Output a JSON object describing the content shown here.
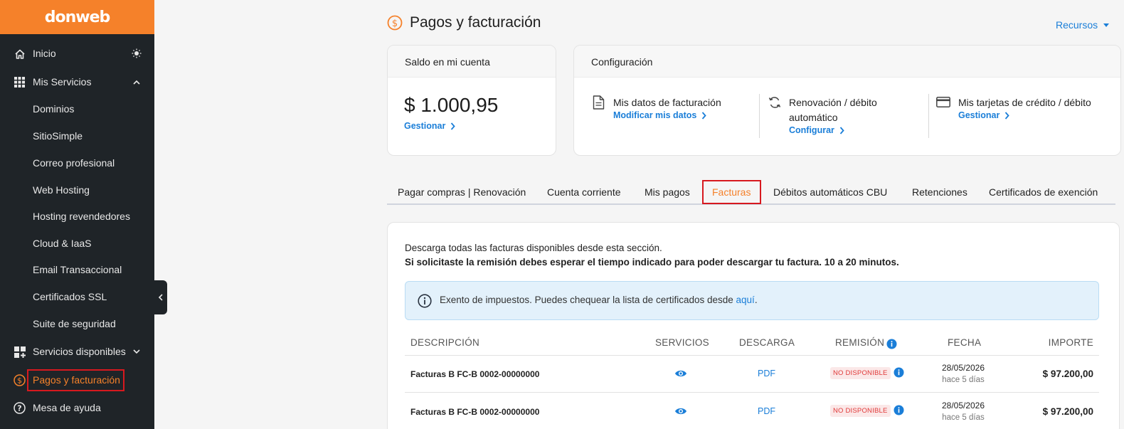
{
  "brand": {
    "logo": "donweb",
    "accent": "#f5812a",
    "link_color": "#1a7ed8"
  },
  "sidebar": {
    "items": [
      {
        "label": "Inicio",
        "icon": "home-icon",
        "right_icon": "sun-icon"
      },
      {
        "label": "Mis Servicios",
        "icon": "grid-icon",
        "right_icon": "chevron-up-icon"
      },
      {
        "label": "Dominios"
      },
      {
        "label": "SitioSimple"
      },
      {
        "label": "Correo profesional"
      },
      {
        "label": "Web Hosting"
      },
      {
        "label": "Hosting revendedores"
      },
      {
        "label": "Cloud & IaaS"
      },
      {
        "label": "Email Transaccional"
      },
      {
        "label": "Certificados SSL"
      },
      {
        "label": "Suite de seguridad"
      },
      {
        "label": "Servicios disponibles",
        "icon": "grid-plus-icon",
        "right_icon": "chevron-down-icon"
      },
      {
        "label": "Pagos y facturación",
        "icon": "dollar-circle-icon",
        "active": true
      },
      {
        "label": "Mesa de ayuda",
        "icon": "help-circle-icon"
      }
    ]
  },
  "header": {
    "title": "Pagos y facturación",
    "resources": "Recursos"
  },
  "balance_card": {
    "title": "Saldo en mi cuenta",
    "amount": "$ 1.000,95",
    "link": "Gestionar"
  },
  "config_card": {
    "title": "Configuración",
    "items": [
      {
        "title": "Mis datos de facturación",
        "link": "Modificar mis datos",
        "icon": "document-icon"
      },
      {
        "title_line1": "Renovación / débito",
        "title_line2": "automático",
        "link": "Configurar",
        "icon": "refresh-icon"
      },
      {
        "title": "Mis tarjetas de crédito / débito",
        "link": "Gestionar",
        "icon": "credit-card-icon"
      }
    ]
  },
  "tabs": [
    "Pagar compras | Renovación",
    "Cuenta corriente",
    "Mis pagos",
    "Facturas",
    "Débitos automáticos CBU",
    "Retenciones",
    "Certificados de exención"
  ],
  "active_tab": "Facturas",
  "invoices": {
    "intro1": "Descarga todas las facturas disponibles desde esta sección.",
    "intro2": "Si solicitaste la remisión debes esperar el tiempo indicado para poder descargar tu factura. 10 a 20 minutos.",
    "alert_text": "Exento de impuestos. Puedes chequear la lista de certificados desde",
    "alert_link": "aquí",
    "alert_end": ".",
    "columns": [
      "DESCRIPCIÓN",
      "SERVICIOS",
      "DESCARGA",
      "REMISIÓN",
      "FECHA",
      "IMPORTE"
    ],
    "rows": [
      {
        "description": "Facturas B FC-B 0002-00000000",
        "download": "PDF",
        "remision": "NO DISPONIBLE",
        "date": "28/05/2026",
        "ago": "hace 5 días",
        "amount": "$ 97.200,00"
      },
      {
        "description": "Facturas B FC-B 0002-00000000",
        "download": "PDF",
        "remision": "NO DISPONIBLE",
        "date": "28/05/2026",
        "ago": "hace 5 días",
        "amount": "$ 97.200,00"
      }
    ]
  }
}
